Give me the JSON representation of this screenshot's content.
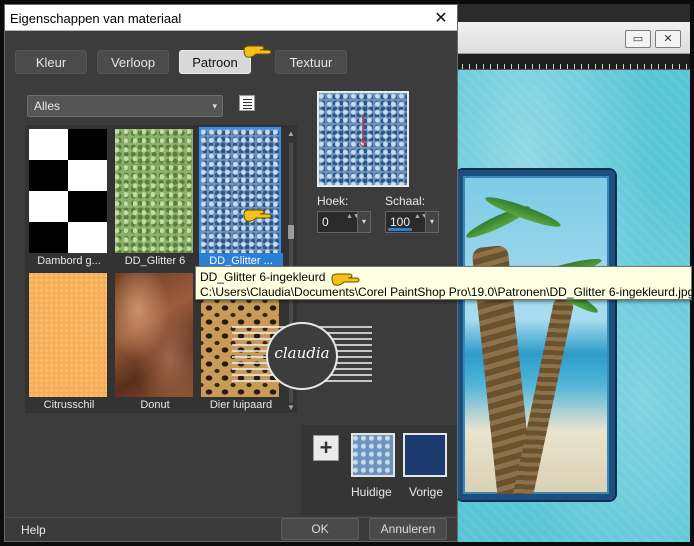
{
  "dialog": {
    "title": "Eigenschappen van materiaal",
    "close_glyph": "✕"
  },
  "tabs": [
    {
      "label": "Kleur"
    },
    {
      "label": "Verloop"
    },
    {
      "label": "Patroon",
      "active": true
    },
    {
      "label": "Textuur"
    }
  ],
  "category_dropdown": {
    "value": "Alles",
    "arrow": "▾"
  },
  "patterns": [
    {
      "label": "Dambord g...",
      "swatch": "checkerboard"
    },
    {
      "label": "DD_Glitter 6",
      "swatch": "green-glitter"
    },
    {
      "label": "DD_Glitter ...",
      "swatch": "blue-glitter",
      "selected": true
    },
    {
      "label": "Citrusschil",
      "swatch": "citrus-peel"
    },
    {
      "label": "Donut",
      "swatch": "donut"
    },
    {
      "label": "Dier luipaard",
      "swatch": "leopard"
    }
  ],
  "scrollbar": {
    "up": "▲",
    "down": "▼"
  },
  "angle": {
    "label": "Hoek:",
    "value": "0"
  },
  "scale": {
    "label": "Schaal:",
    "value": "100"
  },
  "spin_arrows": "▲▼",
  "spin_dropdown": "▾",
  "swatches": {
    "add_glyph": "+",
    "current_label": "Huidige",
    "previous_label": "Vorige",
    "previous_color": "#1c3a6e"
  },
  "footer": {
    "help_label": "Help",
    "ok_label": "OK",
    "cancel_label": "Annuleren"
  },
  "tooltip": {
    "line1": "DD_Glitter 6-ingekleurd",
    "line2": "C:\\Users\\Claudia\\Documents\\Corel PaintShop Pro\\19.0\\Patronen\\DD_Glitter 6-ingekleurd.jpg"
  },
  "watermark": {
    "text": "claudia"
  },
  "background_window": {
    "restore_glyph": "▭",
    "close_glyph": "✕"
  },
  "colors": {
    "selection_blue": "#2c7fd6",
    "pointer_yellow": "#f2c21b",
    "canvas_cyan": "#58c5d6"
  }
}
